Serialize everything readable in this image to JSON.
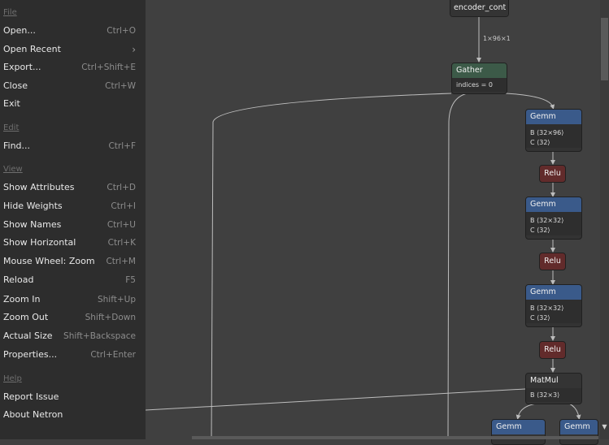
{
  "menu": {
    "file": {
      "title": "File",
      "items": [
        {
          "label": "Open...",
          "shortcut": "Ctrl+O"
        },
        {
          "label": "Open Recent",
          "chevron": "›"
        },
        {
          "label": "Export...",
          "shortcut": "Ctrl+Shift+E"
        },
        {
          "label": "Close",
          "shortcut": "Ctrl+W"
        },
        {
          "label": "Exit",
          "shortcut": ""
        }
      ]
    },
    "edit": {
      "title": "Edit",
      "items": [
        {
          "label": "Find...",
          "shortcut": "Ctrl+F"
        }
      ]
    },
    "view": {
      "title": "View",
      "items": [
        {
          "label": "Show Attributes",
          "shortcut": "Ctrl+D"
        },
        {
          "label": "Hide Weights",
          "shortcut": "Ctrl+I"
        },
        {
          "label": "Show Names",
          "shortcut": "Ctrl+U"
        },
        {
          "label": "Show Horizontal",
          "shortcut": "Ctrl+K"
        },
        {
          "label": "Mouse Wheel: Zoom",
          "shortcut": "Ctrl+M"
        },
        {
          "label": "Reload",
          "shortcut": "F5"
        },
        {
          "label": "Zoom In",
          "shortcut": "Shift+Up"
        },
        {
          "label": "Zoom Out",
          "shortcut": "Shift+Down"
        },
        {
          "label": "Actual Size",
          "shortcut": "Shift+Backspace"
        },
        {
          "label": "Properties...",
          "shortcut": "Ctrl+Enter"
        }
      ]
    },
    "help": {
      "title": "Help",
      "items": [
        {
          "label": "Report Issue"
        },
        {
          "label": "About Netron"
        }
      ]
    }
  },
  "graph": {
    "encoder": {
      "label": "encoder_cont"
    },
    "edge_label": "1×96×1",
    "gather": {
      "label": "Gather",
      "attr": "indices = 0"
    },
    "gemm1": {
      "label": "Gemm",
      "b": "B ⟨32×96⟩",
      "c": "C ⟨32⟩"
    },
    "relu1": {
      "label": "Relu"
    },
    "gemm2": {
      "label": "Gemm",
      "b": "B ⟨32×32⟩",
      "c": "C ⟨32⟩"
    },
    "relu2": {
      "label": "Relu"
    },
    "gemm3": {
      "label": "Gemm",
      "b": "B ⟨32×32⟩",
      "c": "C ⟨32⟩"
    },
    "relu3": {
      "label": "Relu"
    },
    "matmul": {
      "label": "MatMul",
      "b": "B ⟨32×3⟩"
    },
    "gemm4": {
      "label": "Gemm"
    },
    "gemm5": {
      "label": "Gemm"
    }
  },
  "colors": {
    "gather": "#3c5a48",
    "gemm": "#3a5a8a",
    "relu": "#622b2b",
    "menu_bg": "#2d2d2d",
    "canvas_bg": "#404040"
  },
  "icons": {
    "scroll_down": "down-arrow-icon"
  }
}
